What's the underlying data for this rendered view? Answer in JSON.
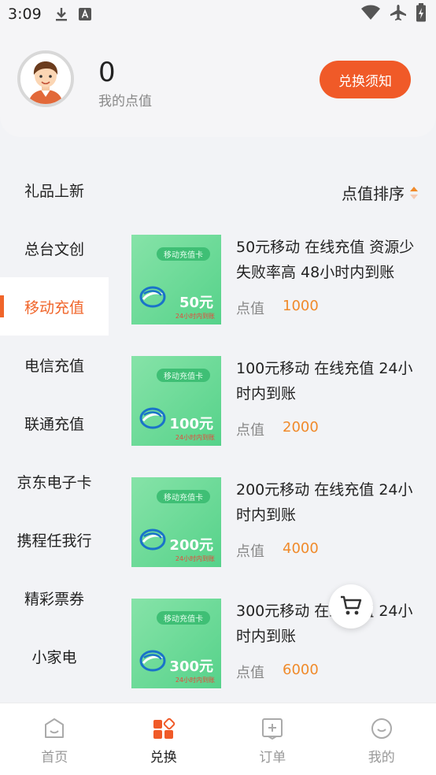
{
  "status_bar": {
    "time": "3:09"
  },
  "header": {
    "points_value": "0",
    "points_label": "我的点值",
    "rules_button": "兑换须知"
  },
  "sidebar": {
    "items": [
      {
        "label": "礼品上新"
      },
      {
        "label": "总台文创"
      },
      {
        "label": "移动充值"
      },
      {
        "label": "电信充值"
      },
      {
        "label": "联通充值"
      },
      {
        "label": "京东电子卡"
      },
      {
        "label": "携程任我行"
      },
      {
        "label": "精彩票券"
      },
      {
        "label": "小家电"
      }
    ],
    "active_index": 2
  },
  "sort": {
    "label": "点值排序"
  },
  "products": [
    {
      "title": "50元移动 在线充值 资源少 失败率高 48小时内到账",
      "price_label": "点值",
      "price": "1000",
      "card_tag": "移动充值卡",
      "card_amount": "50元",
      "card_note": "24小时内到账"
    },
    {
      "title": "100元移动 在线充值 24小时内到账",
      "price_label": "点值",
      "price": "2000",
      "card_tag": "移动充值卡",
      "card_amount": "100元",
      "card_note": "24小时内到账"
    },
    {
      "title": "200元移动  在线充值 24小时内到账",
      "price_label": "点值",
      "price": "4000",
      "card_tag": "移动充值卡",
      "card_amount": "200元",
      "card_note": "24小时内到账"
    },
    {
      "title": "300元移动  在线充值 24小时内到账",
      "price_label": "点值",
      "price": "6000",
      "card_tag": "移动充值卡",
      "card_amount": "300元",
      "card_note": "24小时内到账"
    }
  ],
  "tabbar": {
    "items": [
      {
        "label": "首页",
        "icon": "home-icon"
      },
      {
        "label": "兑换",
        "icon": "exchange-icon"
      },
      {
        "label": "订单",
        "icon": "order-icon"
      },
      {
        "label": "我的",
        "icon": "profile-icon"
      }
    ],
    "active_index": 1
  },
  "colors": {
    "accent": "#f05a28",
    "price": "#f08a2a",
    "card_green": "#56d28a"
  }
}
